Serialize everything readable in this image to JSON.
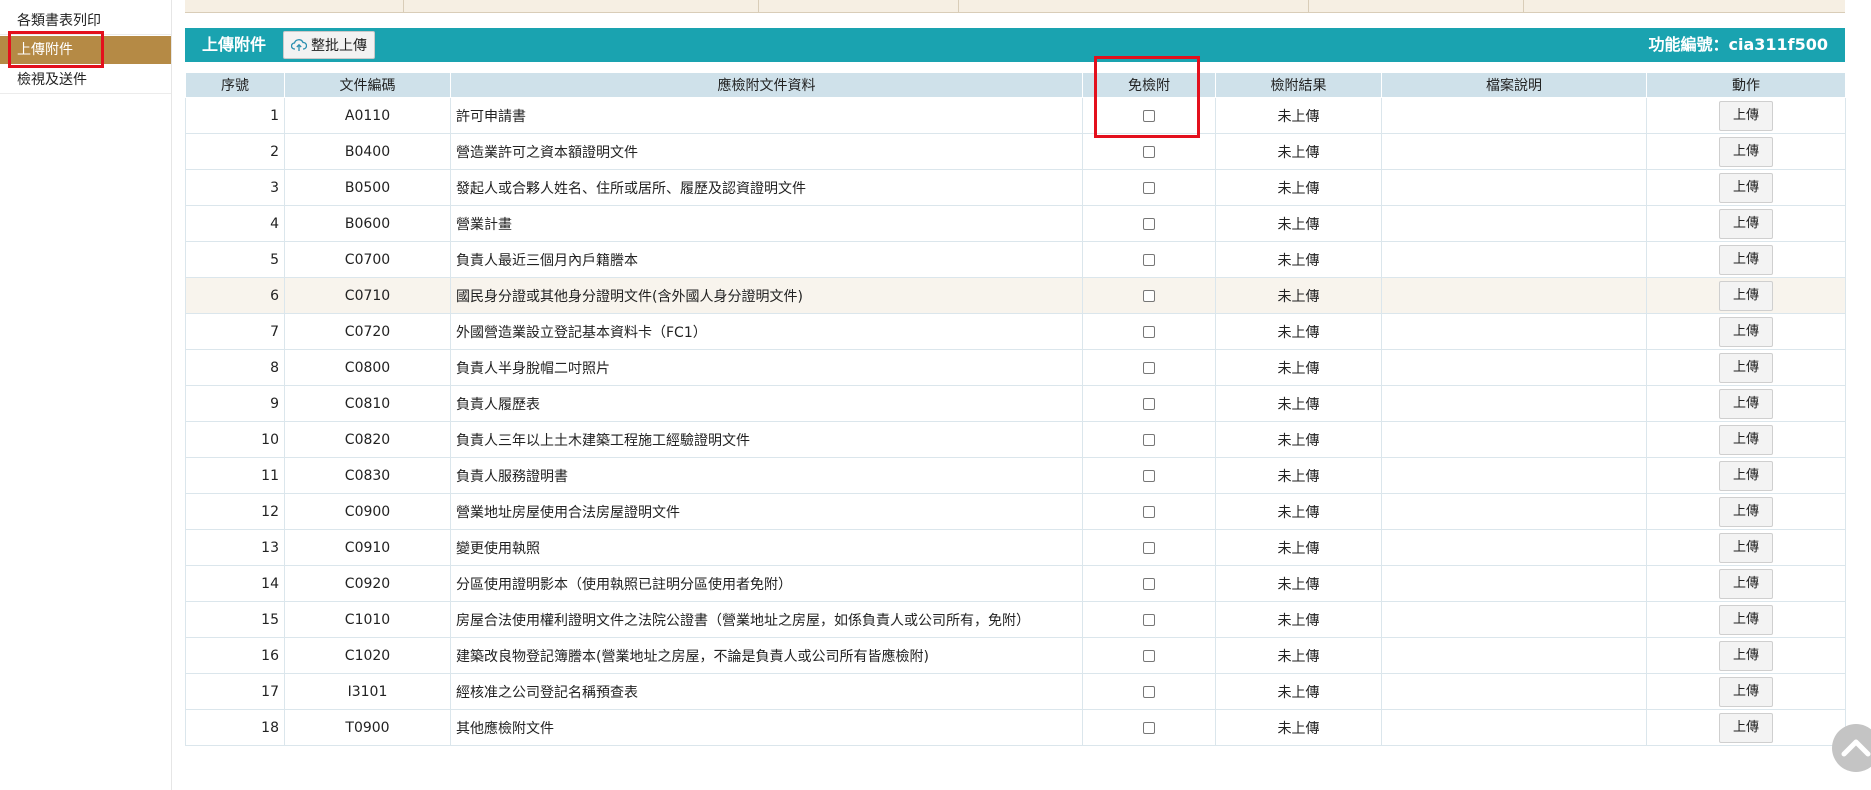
{
  "sidebar": {
    "items": [
      {
        "label": "各類書表列印"
      },
      {
        "label": "上傳附件"
      },
      {
        "label": "檢視及送件"
      }
    ]
  },
  "section": {
    "title": "上傳附件",
    "batch_upload_label": "整批上傳",
    "func_code": "功能編號：cia311f500"
  },
  "table": {
    "headers": [
      "序號",
      "文件編碼",
      "應檢附文件資料",
      "免檢附",
      "檢附結果",
      "檔案說明",
      "動作"
    ],
    "rows": [
      {
        "no": "1",
        "code": "A0110",
        "name": "許可申請書",
        "result": "未上傳",
        "desc": "",
        "action": "上傳"
      },
      {
        "no": "2",
        "code": "B0400",
        "name": "營造業許可之資本額證明文件",
        "result": "未上傳",
        "desc": "",
        "action": "上傳"
      },
      {
        "no": "3",
        "code": "B0500",
        "name": "發起人或合夥人姓名、住所或居所、履歷及認資證明文件",
        "result": "未上傳",
        "desc": "",
        "action": "上傳"
      },
      {
        "no": "4",
        "code": "B0600",
        "name": "營業計畫",
        "result": "未上傳",
        "desc": "",
        "action": "上傳"
      },
      {
        "no": "5",
        "code": "C0700",
        "name": "負責人最近三個月內戶籍謄本",
        "result": "未上傳",
        "desc": "",
        "action": "上傳"
      },
      {
        "no": "6",
        "code": "C0710",
        "name": "國民身分證或其他身分證明文件(含外國人身分證明文件)",
        "result": "未上傳",
        "desc": "",
        "action": "上傳"
      },
      {
        "no": "7",
        "code": "C0720",
        "name": "外國營造業設立登記基本資料卡（FC1）",
        "result": "未上傳",
        "desc": "",
        "action": "上傳"
      },
      {
        "no": "8",
        "code": "C0800",
        "name": "負責人半身脫帽二吋照片",
        "result": "未上傳",
        "desc": "",
        "action": "上傳"
      },
      {
        "no": "9",
        "code": "C0810",
        "name": "負責人履歷表",
        "result": "未上傳",
        "desc": "",
        "action": "上傳"
      },
      {
        "no": "10",
        "code": "C0820",
        "name": "負責人三年以上土木建築工程施工經驗證明文件",
        "result": "未上傳",
        "desc": "",
        "action": "上傳"
      },
      {
        "no": "11",
        "code": "C0830",
        "name": "負責人服務證明書",
        "result": "未上傳",
        "desc": "",
        "action": "上傳"
      },
      {
        "no": "12",
        "code": "C0900",
        "name": "營業地址房屋使用合法房屋證明文件",
        "result": "未上傳",
        "desc": "",
        "action": "上傳"
      },
      {
        "no": "13",
        "code": "C0910",
        "name": "變更使用執照",
        "result": "未上傳",
        "desc": "",
        "action": "上傳"
      },
      {
        "no": "14",
        "code": "C0920",
        "name": "分區使用證明影本（使用執照已註明分區使用者免附）",
        "result": "未上傳",
        "desc": "",
        "action": "上傳"
      },
      {
        "no": "15",
        "code": "C1010",
        "name": "房屋合法使用權利證明文件之法院公證書（營業地址之房屋，如係負責人或公司所有，免附）",
        "result": "未上傳",
        "desc": "",
        "action": "上傳"
      },
      {
        "no": "16",
        "code": "C1020",
        "name": "建築改良物登記簿謄本(營業地址之房屋，不論是負責人或公司所有皆應檢附)",
        "result": "未上傳",
        "desc": "",
        "action": "上傳"
      },
      {
        "no": "17",
        "code": "I3101",
        "name": "經核准之公司登記名稱預查表",
        "result": "未上傳",
        "desc": "",
        "action": "上傳"
      },
      {
        "no": "18",
        "code": "T0900",
        "name": "其他應檢附文件",
        "result": "未上傳",
        "desc": "",
        "action": "上傳"
      }
    ]
  },
  "colors": {
    "accent_teal": "#1aa3b0",
    "sidebar_active": "#b58a45",
    "highlight_red": "#e3101d",
    "header_blue": "#cfe1ea"
  },
  "icons": {
    "batch_upload": "cloud-upload-icon",
    "scroll_top": "chevron-up-icon"
  }
}
